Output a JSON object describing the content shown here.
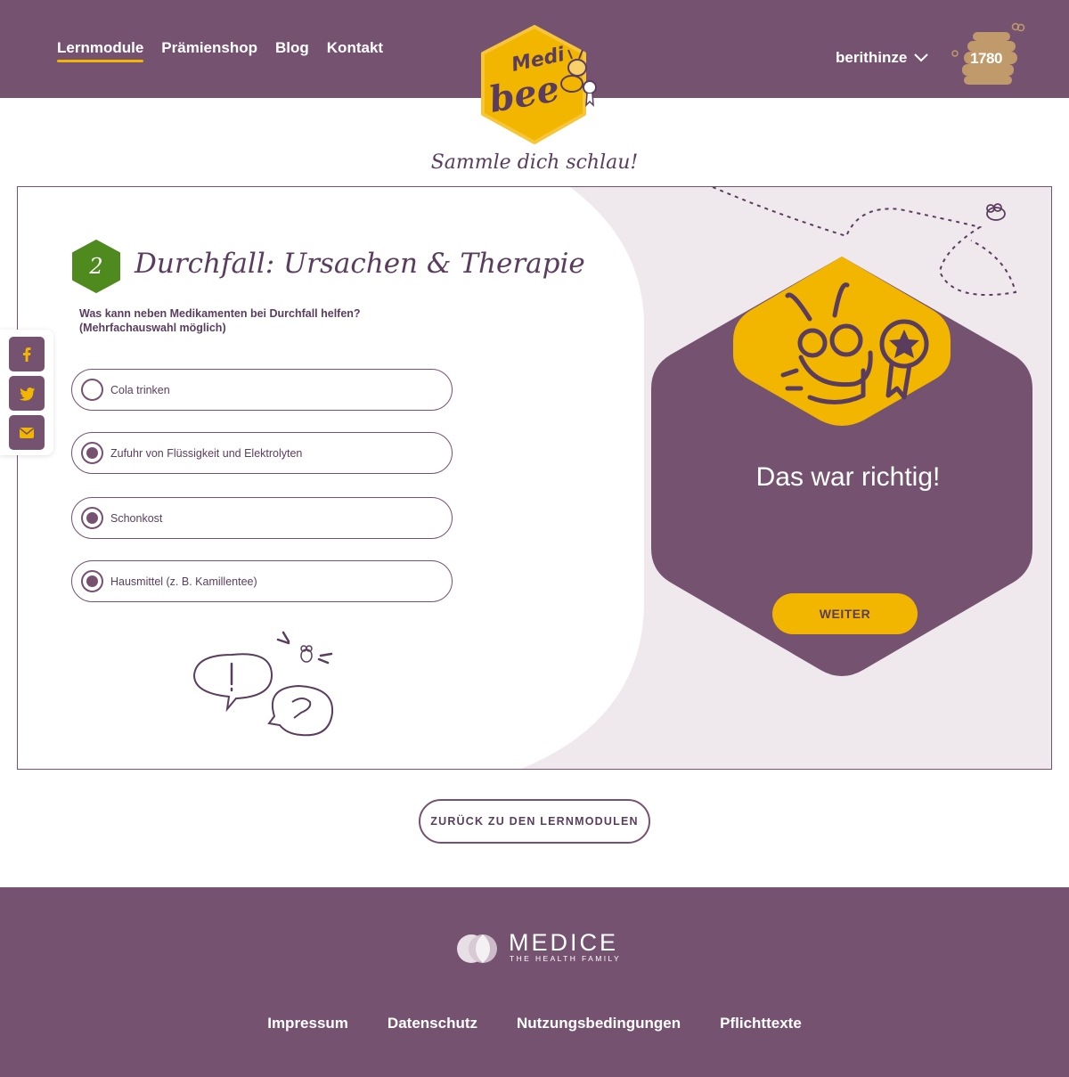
{
  "header": {
    "nav": [
      {
        "label": "Lernmodule",
        "active": true
      },
      {
        "label": "Prämienshop",
        "active": false
      },
      {
        "label": "Blog",
        "active": false
      },
      {
        "label": "Kontakt",
        "active": false
      }
    ],
    "logo_text_top": "Medi",
    "logo_text_bottom": "bee",
    "username": "berithinze",
    "points": "1780"
  },
  "tagline": "Sammle dich schlau!",
  "question": {
    "number": "2",
    "title": "Durchfall: Ursachen & Therapie",
    "text": "Was kann neben Medikamenten bei Durchfall helfen? (Mehrfachauswahl möglich)",
    "options": [
      {
        "label": "Cola trinken",
        "selected": false
      },
      {
        "label": "Zufuhr von Flüssigkeit und Elektrolyten",
        "selected": true
      },
      {
        "label": "Schonkost",
        "selected": true
      },
      {
        "label": "Hausmittel (z. B. Kamillentee)",
        "selected": true
      }
    ]
  },
  "result": {
    "message": "Das war richtig!",
    "next_label": "WEITER"
  },
  "social": [
    "facebook-icon",
    "twitter-icon",
    "mail-icon"
  ],
  "back_label": "ZURÜCK ZU DEN LERNMODULEN",
  "footer": {
    "brand": "MEDICE",
    "brand_sub": "THE HEALTH FAMILY",
    "links": [
      "Impressum",
      "Datenschutz",
      "Nutzungsbedingungen",
      "Pflichttexte"
    ]
  },
  "colors": {
    "purple": "#765271",
    "yellow": "#f2b500",
    "green": "#4e8a1e",
    "light": "#efe9ee"
  }
}
